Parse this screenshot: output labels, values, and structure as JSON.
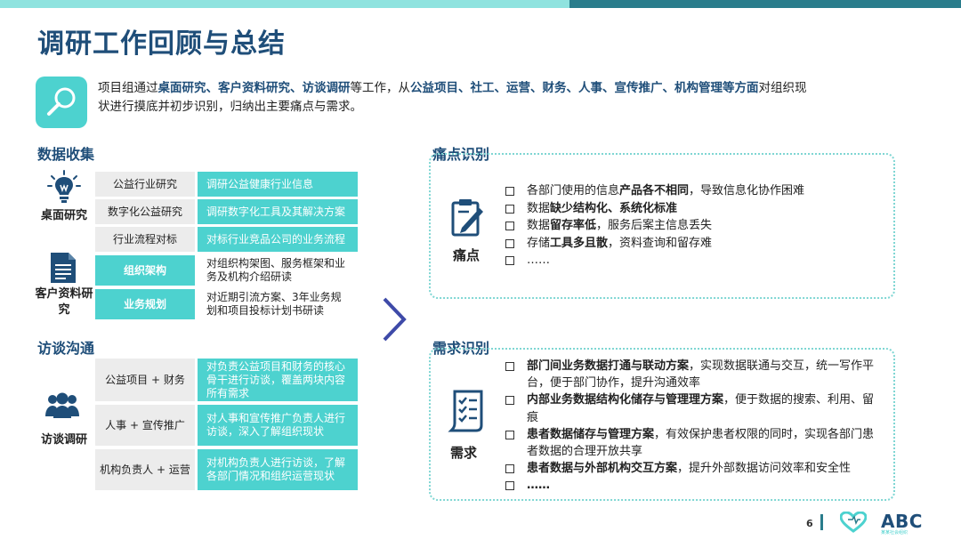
{
  "title": "调研工作回顾与总结",
  "intro": {
    "p1": "项目组通过",
    "b1": "桌面研究、客户资料研究、访谈调研",
    "p2": "等工作，从",
    "b2": "公益项目、社工、运营、财务、人事、宣传推广、机构管理等方面",
    "p3": "对组织现状进行摸底并初步识别，归纳出主要痛点与需求。"
  },
  "data_collection": {
    "heading": "数据收集",
    "desk_label": "桌面研究",
    "client_label": "客户资料研究",
    "rows": [
      {
        "left": "公益行业研究",
        "right": "调研公益健康行业信息"
      },
      {
        "left": "数字化公益研究",
        "right": "调研数字化工具及其解决方案"
      },
      {
        "left": "行业流程对标",
        "right": "对标行业竞品公司的业务流程"
      },
      {
        "left": "组织架构",
        "right": "对组织构架图、服务框架和业务及机构介绍研读"
      },
      {
        "left": "业务规划",
        "right": "对近期引流方案、3年业务规划和项目投标计划书研读"
      }
    ]
  },
  "interview": {
    "heading": "访谈沟通",
    "label": "访谈调研",
    "rows": [
      {
        "left": "公益项目 + 财务",
        "right": "对负责公益项目和财务的核心骨干进行访谈，覆盖两块内容所有需求"
      },
      {
        "left": "人事 + 宣传推广",
        "right": "对人事和宣传推广负责人进行访谈，深入了解组织现状"
      },
      {
        "left": "机构负责人 + 运营",
        "right": "对机构负责人进行访谈，了解各部门情况和组织运营现状"
      }
    ]
  },
  "pain": {
    "heading": "痛点识别",
    "label": "痛点",
    "items": [
      {
        "a": "各部门使用的信息",
        "b": "产品各不相同",
        "c": "，导致信息化协作困难"
      },
      {
        "a": "数据",
        "b": "缺少结构化、系统化标准",
        "c": ""
      },
      {
        "a": "数据",
        "b": "留存率低",
        "c": "，服务后案主信息丢失"
      },
      {
        "a": "存储",
        "b": "工具多且散",
        "c": "，资料查询和留存难"
      },
      {
        "a": "……",
        "b": "",
        "c": ""
      }
    ]
  },
  "needs": {
    "heading": "需求识别",
    "label": "需求",
    "items": [
      {
        "b": "部门间业务数据打通与联动方案",
        "c": "，实现数据联通与交互，统一写作平台，便于部门协作，提升沟通效率"
      },
      {
        "b": "内部业务数据结构化储存与管理理方案",
        "c": "，便于数据的搜索、利用、留痕"
      },
      {
        "b": "患者数据储存与管理方案",
        "c": "，有效保护患者权限的同时，实现各部门患者数据的合理开放共享"
      },
      {
        "b": "患者数据与外部机构交互方案",
        "c": "，提升外部数据访问效率和安全性"
      },
      {
        "b": "……",
        "c": ""
      }
    ]
  },
  "footer": {
    "page": "6",
    "brand": "ABC",
    "brand_sub": "某某社会组织"
  },
  "colors": {
    "primary": "#1f4e79",
    "accent": "#4dd2cf",
    "dark_teal": "#2a7d8c",
    "grey_cell": "#ececec"
  },
  "icons": [
    "search-icon",
    "lightbulb-icon",
    "document-icon",
    "group-icon",
    "clipboard-pen-icon",
    "checklist-icon",
    "chevron-right-icon",
    "heart-logo-icon"
  ]
}
